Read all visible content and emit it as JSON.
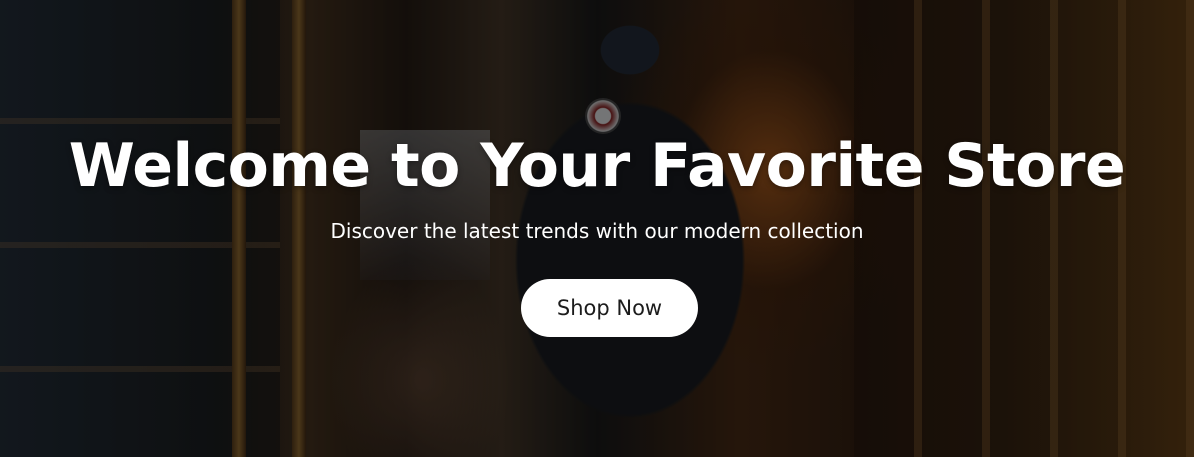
{
  "hero": {
    "title": "Welcome to Your Favorite Store",
    "subtitle": "Discover the latest trends with our modern collection",
    "cta_label": "Shop Now"
  },
  "colors": {
    "text": "#ffffff",
    "button_bg": "#ffffff",
    "button_text": "#1c1c1c",
    "overlay": "rgba(0,0,0,0.38)"
  }
}
